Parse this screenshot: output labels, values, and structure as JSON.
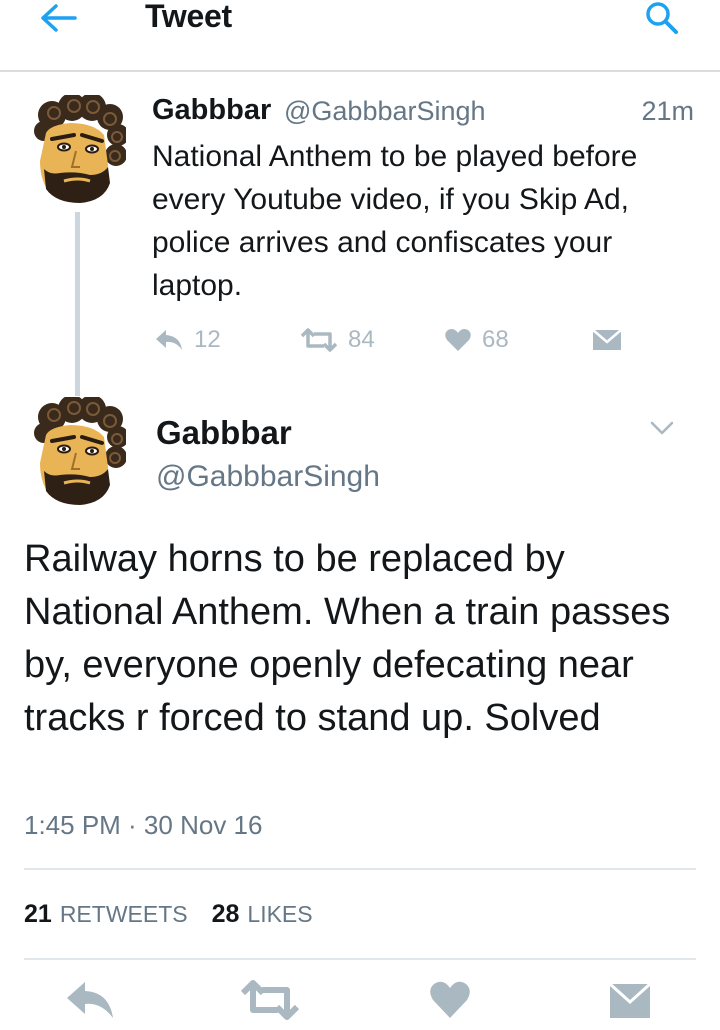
{
  "header": {
    "title": "Tweet",
    "back_icon": "arrow-left-icon",
    "search_icon": "search-icon",
    "accent_color": "#1da1f2"
  },
  "parent_tweet": {
    "name": "Gabbbar",
    "handle": "@GabbbarSingh",
    "time": "21m",
    "text": "National Anthem to be played before every Youtube video, if you Skip Ad, police arrives and confiscates your laptop.",
    "reply_count": "12",
    "retweet_count": "84",
    "like_count": "68"
  },
  "main_tweet": {
    "name": "Gabbbar",
    "handle": "@GabbbarSingh",
    "text": "Railway horns to be replaced by National Anthem. When a train passes by, everyone openly defecating near tracks r forced to stand up. Solved",
    "timestamp": "1:45 PM · 30 Nov 16",
    "retweets": "21",
    "retweets_label": "RETWEETS",
    "likes": "28",
    "likes_label": "LIKES"
  },
  "colors": {
    "text": "#14171a",
    "secondary": "#657786",
    "icon_gray": "#aab8c2",
    "divider": "#e1e8ed",
    "thread_line": "#ccd6dd"
  }
}
